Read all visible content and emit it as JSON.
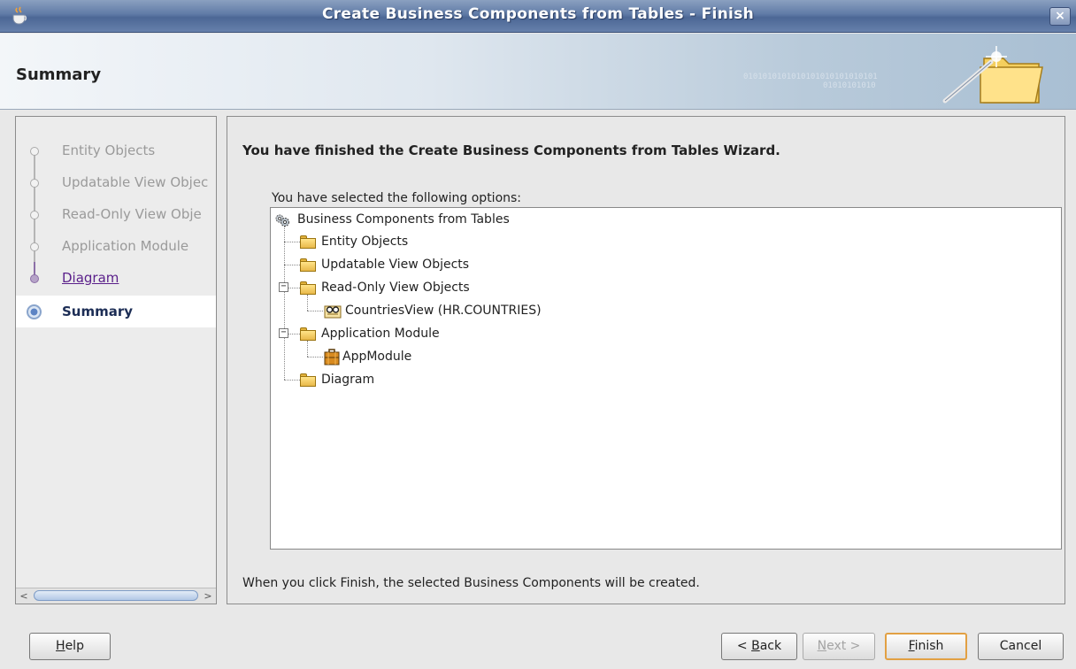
{
  "window": {
    "title": "Create Business Components from Tables - Finish",
    "close_label": "×"
  },
  "header": {
    "title": "Summary",
    "binary_a": "0101010101010101010101010101",
    "binary_b": "01010101010"
  },
  "steps": [
    {
      "label": "Entity Objects",
      "state": "done"
    },
    {
      "label": "Updatable View Objec",
      "state": "done"
    },
    {
      "label": "Read-Only View Obje",
      "state": "done"
    },
    {
      "label": "Application Module",
      "state": "done"
    },
    {
      "label": "Diagram",
      "state": "visited"
    },
    {
      "label": "Summary",
      "state": "current"
    }
  ],
  "main": {
    "finished_message": "You have finished the Create Business Components from Tables Wizard.",
    "options_label": "You have selected the following options:",
    "finish_note": "When you click Finish, the selected Business Components will be created."
  },
  "tree": {
    "root": "Business Components from Tables",
    "entity_objects": "Entity Objects",
    "updatable_view_objects": "Updatable View Objects",
    "read_only_view_objects": "Read-Only View Objects",
    "countries_view": "CountriesView (HR.COUNTRIES)",
    "application_module": "Application Module",
    "app_module": "AppModule",
    "diagram": "Diagram",
    "collapse_symbol": "−"
  },
  "buttons": {
    "help": {
      "prefix": "",
      "mnemonic": "H",
      "suffix": "elp"
    },
    "back": {
      "prefix": "< ",
      "mnemonic": "B",
      "suffix": "ack"
    },
    "next": {
      "prefix": "",
      "mnemonic": "N",
      "suffix": "ext >"
    },
    "finish": {
      "prefix": "",
      "mnemonic": "F",
      "suffix": "inish"
    },
    "cancel": "Cancel"
  },
  "scrollbar": {
    "left_arrow": "<",
    "right_arrow": ">"
  }
}
